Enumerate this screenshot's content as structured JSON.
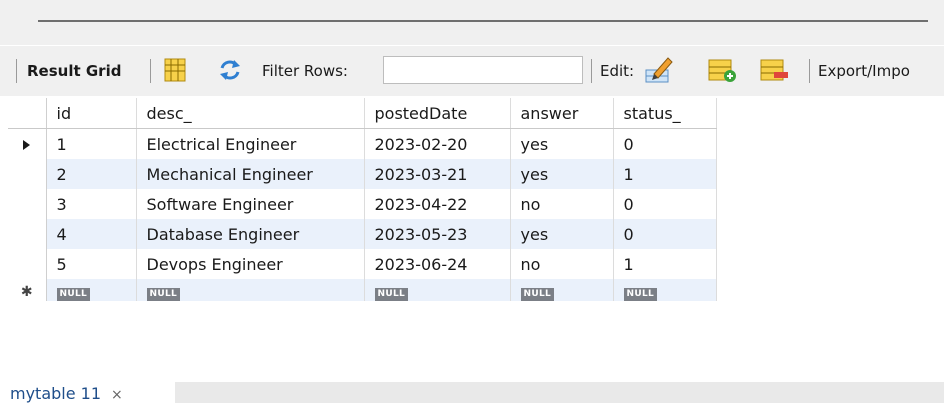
{
  "toolbar": {
    "result_grid_label": "Result Grid",
    "filter_rows_label": "Filter Rows:",
    "filter_value": "",
    "edit_label": "Edit:",
    "export_label": "Export/Impo"
  },
  "grid": {
    "columns": [
      "id",
      "desc_",
      "postedDate",
      "answer",
      "status_"
    ],
    "rows": [
      {
        "id": "1",
        "desc": "Electrical Engineer",
        "posted": "2023-02-20",
        "answer": "yes",
        "status": "0"
      },
      {
        "id": "2",
        "desc": "Mechanical Engineer",
        "posted": "2023-03-21",
        "answer": "yes",
        "status": "1"
      },
      {
        "id": "3",
        "desc": "Software Engineer",
        "posted": "2023-04-22",
        "answer": "no",
        "status": "0"
      },
      {
        "id": "4",
        "desc": "Database Engineer",
        "posted": "2023-05-23",
        "answer": "yes",
        "status": "0"
      },
      {
        "id": "5",
        "desc": "Devops Engineer",
        "posted": "2023-06-24",
        "answer": "no",
        "status": "1"
      }
    ],
    "null_label": "NULL"
  },
  "tabs": {
    "active_label": "mytable 11",
    "close_glyph": "×"
  },
  "icons": {
    "form_editor": "form-editor-icon",
    "refresh": "refresh-icon",
    "edit_row": "edit-row-icon",
    "add_row": "add-row-icon",
    "delete_row": "delete-row-icon"
  }
}
